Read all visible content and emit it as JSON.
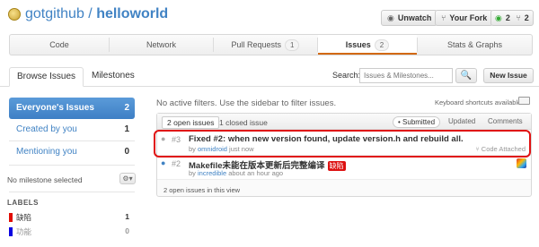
{
  "repo": {
    "owner": "gotgithub",
    "separator": " / ",
    "name": "helloworld"
  },
  "header_buttons": {
    "unwatch": "Unwatch",
    "your_fork": "Your Fork",
    "watchers": "2",
    "forks": "2"
  },
  "tabs": [
    {
      "label": "Code",
      "count": ""
    },
    {
      "label": "Network",
      "count": ""
    },
    {
      "label": "Pull Requests",
      "count": "1"
    },
    {
      "label": "Issues",
      "count": "2"
    },
    {
      "label": "Stats & Graphs",
      "count": ""
    }
  ],
  "subnav": {
    "browse": "Browse Issues",
    "milestones": "Milestones",
    "search_label": "Search:",
    "search_placeholder": "Issues & Milestones...",
    "new_issue": "New Issue"
  },
  "sidebar": {
    "items": [
      {
        "label": "Everyone's Issues",
        "count": "2"
      },
      {
        "label": "Created by you",
        "count": "1"
      },
      {
        "label": "Mentioning you",
        "count": "0"
      }
    ],
    "milestone": "No milestone selected",
    "labels_heading": "LABELS",
    "labels": [
      {
        "name": "缺陷",
        "count": "1",
        "color": "#e10c02"
      },
      {
        "name": "功能",
        "count": "0",
        "color": "#0b02e1"
      }
    ]
  },
  "main": {
    "filter_info": "No active filters. Use the sidebar to filter issues.",
    "keyboard": "Keyboard shortcuts available",
    "state_tabs": [
      "2 open issues",
      "1 closed issue"
    ],
    "sort": [
      "Submitted",
      "Updated",
      "Comments"
    ],
    "issues": [
      {
        "number": "#3",
        "title": "Fixed #2: when new version found, update version.h and rebuild all.",
        "by": "by",
        "author": "omnidroid",
        "time": "just now",
        "attached": "Code Attached"
      },
      {
        "number": "#2",
        "title": "Makefile未能在版本更新后完整编译",
        "label": "缺陷",
        "by": "by",
        "author": "incredible",
        "time": "about an hour ago"
      }
    ],
    "footer": "2 open issues in this view"
  },
  "colors": {
    "accent": "#4183c4",
    "highlight": "#e01111",
    "active_tab": "#d26911"
  }
}
